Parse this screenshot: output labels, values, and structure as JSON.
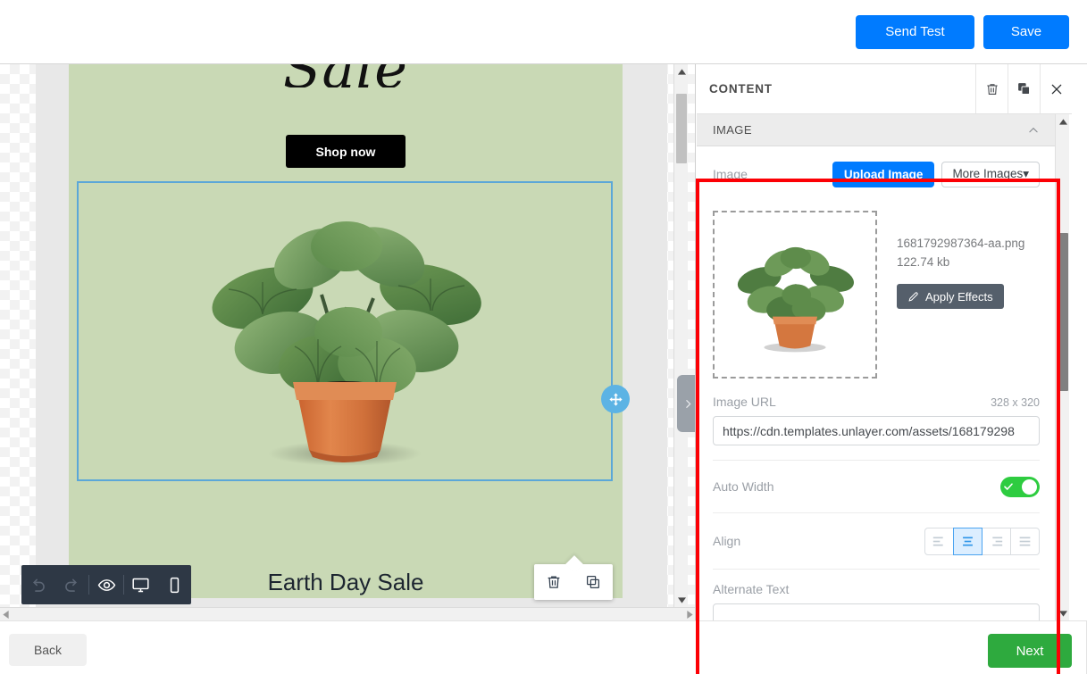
{
  "topbar": {
    "send_test_label": "Send Test",
    "save_label": "Save"
  },
  "canvas": {
    "heading_script": "Sale",
    "shop_now_label": "Shop now",
    "footer_heading": "Earth Day Sale",
    "selection_border_color": "#5ba7d8",
    "email_bg_color": "#c9d9b5",
    "move_handle_icon": "move-arrows-icon",
    "float_actions": [
      {
        "icon": "trash-icon",
        "name": "delete-block-button"
      },
      {
        "icon": "duplicate-icon",
        "name": "duplicate-block-button"
      }
    ],
    "toolbar": [
      {
        "icon": "undo-icon",
        "name": "undo-button"
      },
      {
        "icon": "redo-icon",
        "name": "redo-button"
      },
      {
        "icon": "eye-icon",
        "name": "preview-button"
      },
      {
        "icon": "desktop-icon",
        "name": "desktop-view-button"
      },
      {
        "icon": "mobile-icon",
        "name": "mobile-view-button"
      }
    ],
    "expand_tab_icon": "chevron-right-icon"
  },
  "panel": {
    "title": "CONTENT",
    "header_actions": [
      {
        "icon": "trash-icon",
        "name": "panel-delete-button"
      },
      {
        "icon": "duplicate-icon",
        "name": "panel-duplicate-button"
      },
      {
        "icon": "close-icon",
        "name": "panel-close-button"
      }
    ],
    "section": {
      "title": "IMAGE",
      "collapse_icon": "chevron-up-icon"
    },
    "image_row": {
      "label": "Image",
      "upload_label": "Upload Image",
      "more_images_label": "More Images",
      "more_images_caret": "▾"
    },
    "thumbnail": {
      "alt": "potted-plant",
      "file_name": "1681792987364-aa.png",
      "file_size": "122.74 kb",
      "apply_effects_label": "Apply Effects",
      "apply_effects_icon": "pencil-icon"
    },
    "image_url": {
      "label": "Image URL",
      "dimensions": "328 x 320",
      "value": "https://cdn.templates.unlayer.com/assets/168179298",
      "placeholder": "Image URL"
    },
    "auto_width": {
      "label": "Auto Width",
      "enabled": true,
      "toggle_on_color": "#2ecc40",
      "check_icon": "check-icon"
    },
    "align": {
      "label": "Align",
      "selected": "center",
      "options": [
        {
          "value": "left",
          "icon": "align-left-icon"
        },
        {
          "value": "center",
          "icon": "align-center-icon"
        },
        {
          "value": "right",
          "icon": "align-right-icon"
        },
        {
          "value": "justify",
          "icon": "align-justify-icon"
        }
      ],
      "active_color": "#4aa3f0"
    },
    "alternate_text": {
      "label": "Alternate Text",
      "value": "",
      "placeholder": ""
    },
    "highlight_color": "#fc0005"
  },
  "footer": {
    "back_label": "Back",
    "next_label": "Next",
    "next_color": "#2eaa3e"
  }
}
